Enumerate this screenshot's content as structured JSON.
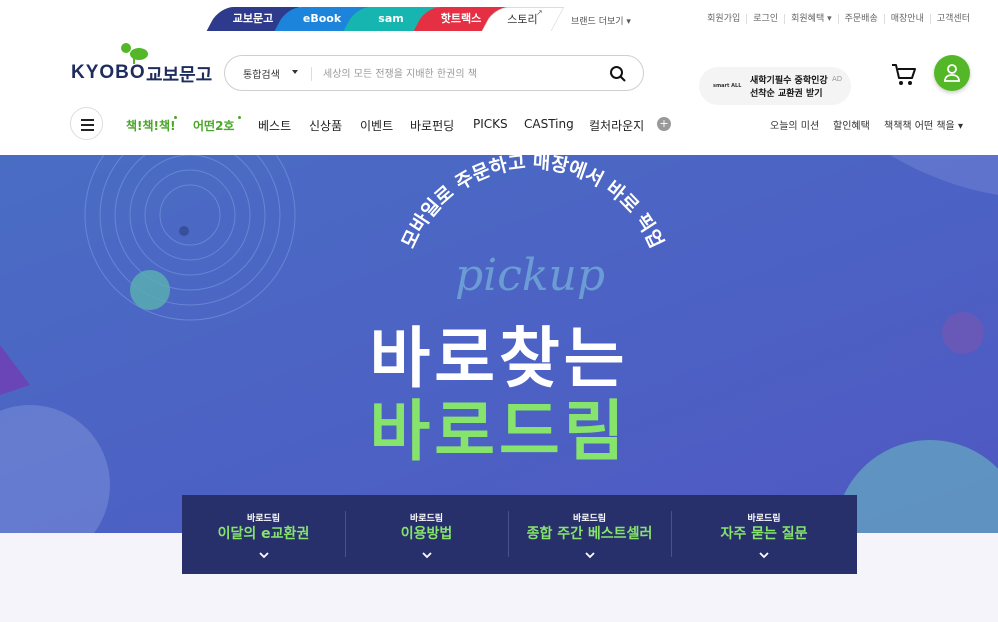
{
  "site_tabs": [
    "교보문고",
    "eBook",
    "sam",
    "핫트랙스",
    "스토리"
  ],
  "brand_more": "브랜드 더보기",
  "top_links": [
    "회원가입",
    "로그인",
    "회원혜택",
    "주문배송",
    "매장안내",
    "고객센터"
  ],
  "logo": {
    "en": "KYOBO",
    "kr": "교보문고"
  },
  "search": {
    "scope": "통합검색",
    "placeholder": "세상의 모든 전쟁을 지배한 한권의 책"
  },
  "promo": {
    "brand": "smart ALL",
    "line1": "새학기필수 중학인강",
    "line2": "선착순 교환권 받기",
    "ad": "AD"
  },
  "nav": [
    "책!책!책!",
    "어떤2호",
    "베스트",
    "신상품",
    "이벤트",
    "바로펀딩",
    "PICKS",
    "CASTing",
    "컬처라운지"
  ],
  "right_nav": [
    "오늘의 미션",
    "할인혜택",
    "책책책 어떤 책을"
  ],
  "hero": {
    "arc_text": "모바일로 주문하고 매장에서 바로 픽업",
    "script": "pickup",
    "title1": "바로찾는",
    "title2": "바로드림"
  },
  "hero_tabs": [
    {
      "small": "바로드림",
      "label": "이달의 e교환권"
    },
    {
      "small": "바로드림",
      "label": "이용방법"
    },
    {
      "small": "바로드림",
      "label": "종합 주간 베스트셀러"
    },
    {
      "small": "바로드림",
      "label": "자주 묻는 질문"
    }
  ],
  "colors": {
    "green": "#53b728",
    "navy": "#1f2c5e",
    "tab_bg": "#28306b",
    "accent_green": "#86e36c"
  }
}
